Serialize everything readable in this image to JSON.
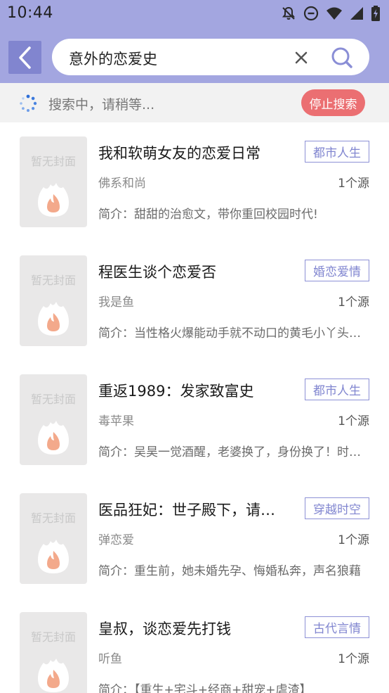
{
  "status_bar": {
    "time": "10:44",
    "icons": [
      "notifications-off-icon",
      "do-not-disturb-icon",
      "wifi-icon",
      "signal-icon",
      "battery-charging-icon"
    ]
  },
  "header": {
    "background": "#a3a6e0",
    "search": {
      "query": "意外的恋爱史"
    }
  },
  "search_status": {
    "text": "搜索中，请稍等...",
    "stop_label": "停止搜索",
    "stop_color": "#eb6f72"
  },
  "books": [
    {
      "cover_text": "暂无封面",
      "title": "我和软萌女友的恋爱日常",
      "tag": "都市人生",
      "author": "佛系和尚",
      "source": "1个源",
      "intro": "简介：甜甜的治愈文，带你重回校园时代!"
    },
    {
      "cover_text": "暂无封面",
      "title": "程医生谈个恋爱否",
      "tag": "婚恋爱情",
      "author": "我是鱼",
      "source": "1个源",
      "intro": "简介：当性格火爆能动手就不动口的黄毛小丫头遇上温文尔雅的程医生"
    },
    {
      "cover_text": "暂无封面",
      "title": "重返1989：发家致富史",
      "tag": "都市人生",
      "author": "毒苹果",
      "source": "1个源",
      "intro": "简介：吴昊一觉酒醒，老婆换了，身份换了！时代也变了"
    },
    {
      "cover_text": "暂无封面",
      "title": "医品狂妃：世子殿下，请…",
      "tag": "穿越时空",
      "author": "弹恋爱",
      "source": "1个源",
      "intro": "简介：重生前，她未婚先孕、悔婚私奔，声名狼藉"
    },
    {
      "cover_text": "暂无封面",
      "title": "皇叔，谈恋爱先打钱",
      "tag": "古代言情",
      "author": "听鱼",
      "source": "1个源",
      "intro": "简介：【重生+宅斗+经商+甜宠+虐渣】"
    }
  ]
}
